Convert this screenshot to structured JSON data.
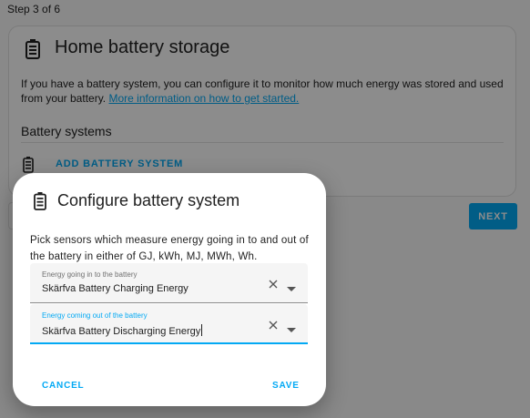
{
  "page": {
    "step_text": "Step 3 of 6",
    "card": {
      "title": "Home battery storage",
      "icon": "battery-icon",
      "description": "If you have a battery system, you can configure it to monitor how much energy was stored and used from your battery.",
      "link_text": "More information on how to get started.",
      "systems_title": "Battery systems",
      "add_button": "ADD BATTERY SYSTEM"
    },
    "next_button": "NEXT"
  },
  "dialog": {
    "title": "Configure battery system",
    "icon": "battery-icon",
    "description": "Pick sensors which measure energy going in to and out of the battery in either of GJ, kWh, MJ, MWh, Wh.",
    "fields": [
      {
        "label": "Energy going in to the battery",
        "value": "Skärfva Battery Charging Energy"
      },
      {
        "label": "Energy coming out of the battery",
        "value": "Skärfva Battery Discharging Energy"
      }
    ],
    "cancel_label": "CANCEL",
    "save_label": "SAVE"
  },
  "colors": {
    "accent": "#03a9f4",
    "text": "#212121",
    "scrim": "rgba(0,0,0,0.45)"
  }
}
